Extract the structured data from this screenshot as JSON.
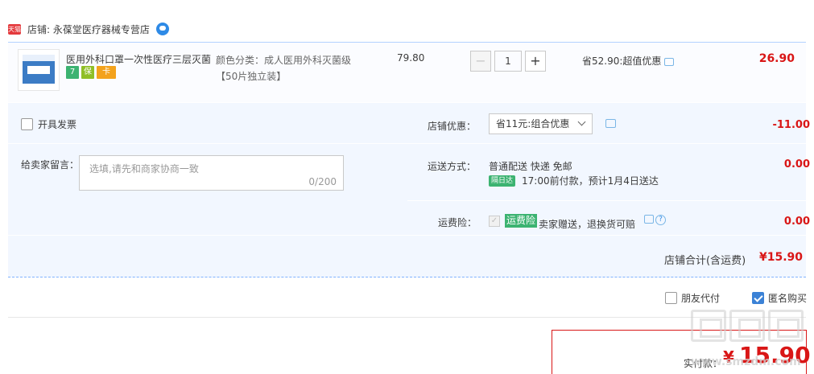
{
  "shop": {
    "label": "店铺: 永葆堂医疗器械专营店",
    "tmall_badge": "天猫"
  },
  "item": {
    "title": "医用外科口罩一次性医疗三层灭菌",
    "sku_label": "颜色分类：成人医用外科灭菌级",
    "sku_label2": "【50片独立装】",
    "price": "79.80",
    "quantity": "1",
    "minus": "−",
    "plus": "+",
    "save_text": "省52.90:超值优惠",
    "subtotal": "26.90",
    "service_icons": [
      "7",
      "保",
      "卡"
    ]
  },
  "invoice": {
    "label": "开具发票"
  },
  "message": {
    "label": "给卖家留言：",
    "placeholder": "选填,请先和商家协商一致",
    "count": "0/200"
  },
  "discount": {
    "label": "店铺优惠：",
    "selected": "省11元:组合优惠",
    "amount": "-11.00"
  },
  "shipping": {
    "label": "运送方式：",
    "method": "普通配送 快递 免邮",
    "badge": "隔日达",
    "eta": "17:00前付款，预计1月4日送达",
    "amount": "0.00"
  },
  "insurance": {
    "label": "运费险：",
    "badge": "运费险",
    "text": "卖家赠送，退换货可赔",
    "help": "?",
    "amount": "0.00"
  },
  "total": {
    "label": "店铺合计(含运费)",
    "amount": "¥15.90"
  },
  "options": {
    "friend_pay": "朋友代付",
    "anonymous": "匿名购买"
  },
  "payment": {
    "label": "实付款：",
    "currency": "¥",
    "amount": "15.90"
  },
  "watermark": {
    "url": "www.smzdm.com"
  },
  "colors": {
    "accent_red": "#d91616",
    "band_blue": "#f2f7ff",
    "checkbox_blue": "#3b82d6",
    "badge_green": "#3cb371"
  }
}
